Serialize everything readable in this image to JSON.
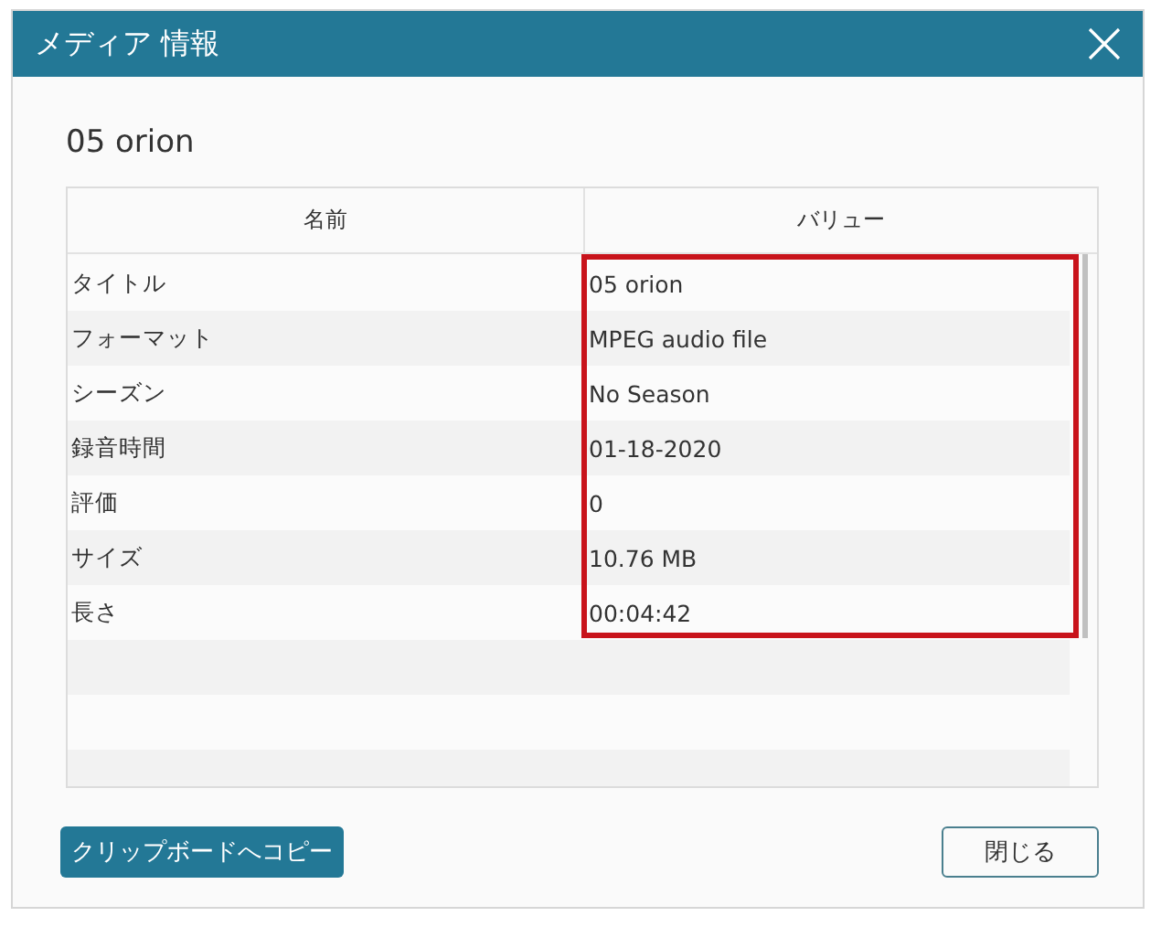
{
  "window": {
    "title": "メディア 情報"
  },
  "heading": "05 orion",
  "table": {
    "columns": [
      "名前",
      "バリュー"
    ],
    "rows": [
      {
        "name": "タイトル",
        "value": "05 orion"
      },
      {
        "name": "フォーマット",
        "value": "MPEG audio file"
      },
      {
        "name": "シーズン",
        "value": "No Season"
      },
      {
        "name": "録音時間",
        "value": "01-18-2020"
      },
      {
        "name": "評価",
        "value": "0"
      },
      {
        "name": "サイズ",
        "value": "10.76 MB"
      },
      {
        "name": "長さ",
        "value": "00:04:42"
      }
    ],
    "values_highlighted": true
  },
  "buttons": [
    {
      "label": "クリップボードへコピー",
      "kind": "primary"
    },
    {
      "label": "閉じる",
      "kind": "secondary"
    }
  ]
}
